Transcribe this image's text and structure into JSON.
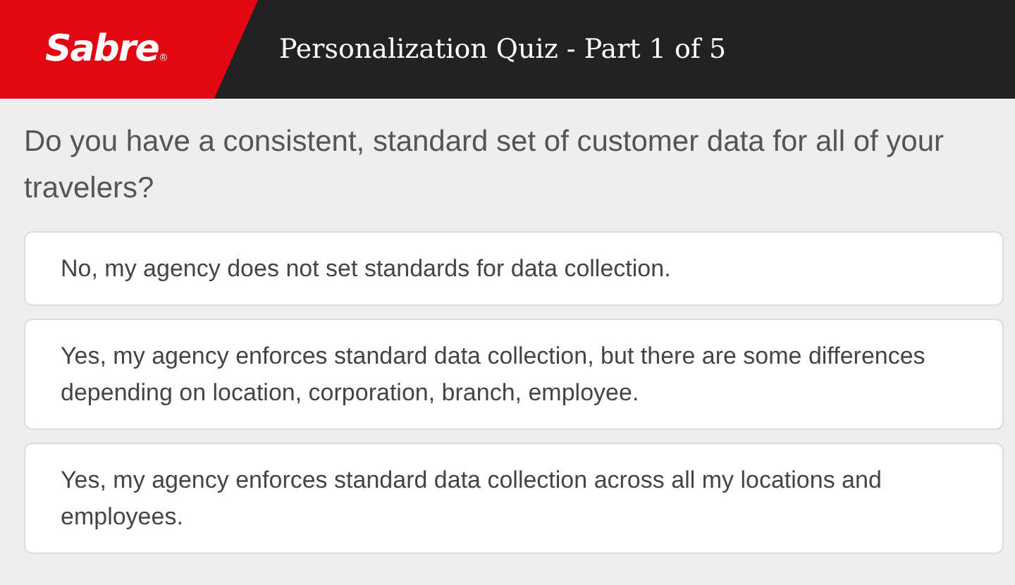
{
  "header": {
    "logo": "Sabre",
    "logo_mark": "®",
    "title": "Personalization Quiz - Part 1 of 5"
  },
  "question": "Do you have a consistent, standard set of customer data for all of your travelers?",
  "answers": [
    {
      "label": "No, my agency does not set standards for data collection."
    },
    {
      "label": "Yes, my agency enforces standard data collection, but there are some differences depending on location, corporation, branch, employee."
    },
    {
      "label": "Yes, my agency enforces standard data collection across all my locations and employees."
    }
  ]
}
